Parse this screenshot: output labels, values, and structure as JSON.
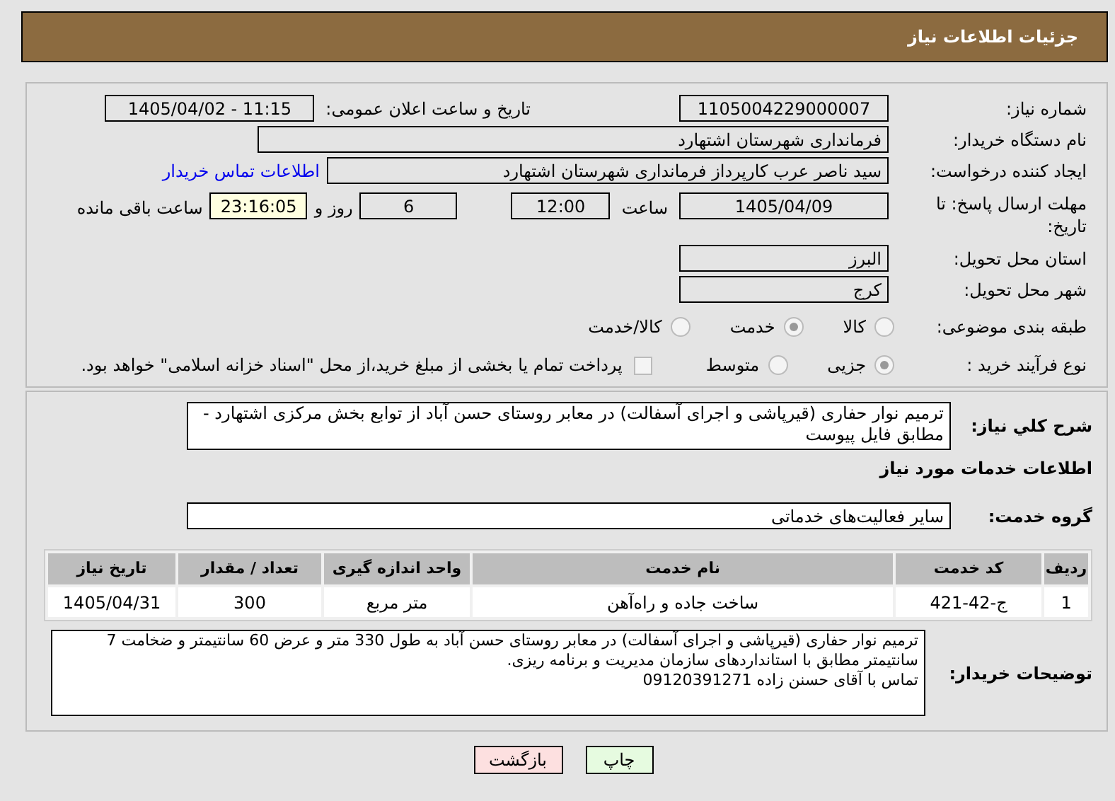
{
  "header": {
    "title": "جزئیات اطلاعات نیاز"
  },
  "need_number": {
    "label": "شماره نیاز:",
    "value": "1105004229000007"
  },
  "announce": {
    "label": "تاریخ و ساعت اعلان عمومی:",
    "value": "1405/04/02 - 11:15"
  },
  "buyer": {
    "label": "نام دستگاه خریدار:",
    "value": "فرمانداری شهرستان اشتهارد"
  },
  "creator": {
    "label": "ایجاد کننده درخواست:",
    "value": "سید ناصر  عرب کارپرداز فرمانداری شهرستان اشتهارد",
    "link": "اطلاعات تماس خریدار"
  },
  "deadline": {
    "label": "مهلت ارسال پاسخ: تا تاریخ:",
    "date": "1405/04/09",
    "time_label": "ساعت",
    "time": "12:00",
    "days": "6",
    "days_label": "روز و",
    "remaining": "23:16:05",
    "remaining_label": "ساعت باقی مانده"
  },
  "province": {
    "label": "استان محل تحویل:",
    "value": "البرز"
  },
  "city": {
    "label": "شهر محل تحویل:",
    "value": "کرج"
  },
  "category": {
    "label": "طبقه بندی موضوعی:",
    "options": [
      {
        "label": "کالا",
        "selected": false
      },
      {
        "label": "خدمت",
        "selected": true
      },
      {
        "label": "کالا/خدمت",
        "selected": false
      }
    ]
  },
  "process": {
    "label": "نوع فرآیند خرید :",
    "options": [
      {
        "label": "جزیی",
        "selected": true
      },
      {
        "label": "متوسط",
        "selected": false
      }
    ],
    "payment": {
      "checked": false,
      "label": "پرداخت تمام یا بخشی از مبلغ خرید،از محل \"اسناد خزانه اسلامی\" خواهد بود."
    }
  },
  "summary": {
    "label": "شرح کلي نیاز:",
    "value": "ترمیم نوار حفاری (قیرپاشی و اجرای آسفالت) در معابر روستای حسن آباد از توابع بخش مرکزی اشتهارد - مطابق فایل پیوست"
  },
  "services_title": "اطلاعات خدمات مورد نیاز",
  "service_group": {
    "label": "گروه خدمت:",
    "value": "سایر فعالیت‌های خدماتی"
  },
  "table": {
    "columns": [
      "ردیف",
      "کد خدمت",
      "نام خدمت",
      "واحد اندازه گیری",
      "تعداد / مقدار",
      "تاریخ نیاز"
    ],
    "rows": [
      [
        "1",
        "ج-42-421",
        "ساخت جاده و راه‌آهن",
        "متر مربع",
        "300",
        "1405/04/31"
      ]
    ]
  },
  "buyer_notes": {
    "label": "توضیحات خریدار:",
    "lines": [
      "ترمیم نوار حفاری (قیرپاشی و اجرای آسفالت) در معابر روستای حسن آباد به طول 330 متر و عرض 60 سانتیمتر و ضخامت 7 سانتیمتر مطابق با استانداردهای سازمان مدیریت و برنامه ریزی.",
      "تماس با آقای حسنن زاده    09120391271"
    ]
  },
  "buttons": [
    {
      "label": "چاپ",
      "kind": "print"
    },
    {
      "label": "بازگشت",
      "kind": "back"
    }
  ]
}
